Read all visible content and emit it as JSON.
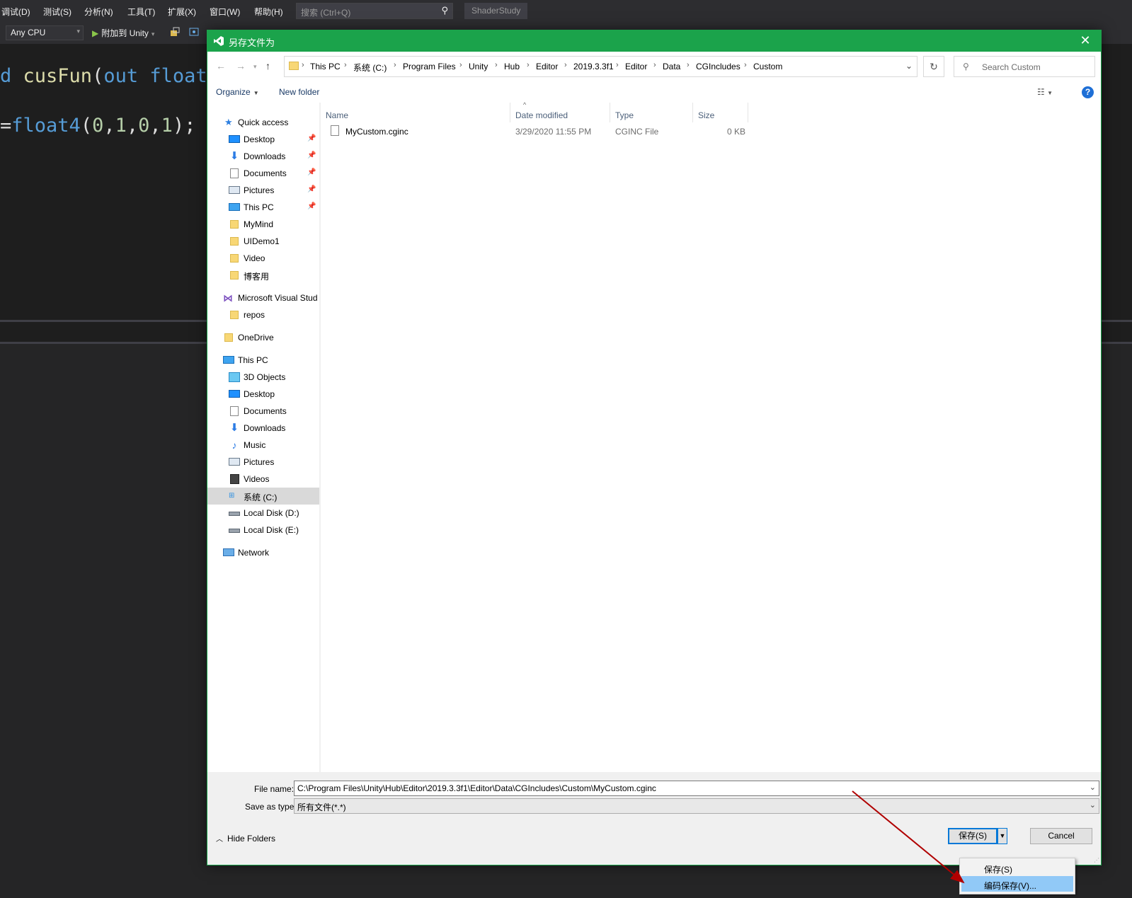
{
  "vs": {
    "menu": [
      "调试(D)",
      "测试(S)",
      "分析(N)",
      "工具(T)",
      "扩展(X)",
      "窗口(W)",
      "帮助(H)"
    ],
    "search_placeholder": "搜索 (Ctrl+Q)",
    "project_name": "ShaderStudy",
    "platform": "Any CPU",
    "run_label": "附加到 Unity",
    "code": {
      "line1": {
        "frag_d": "d",
        "fn": "cusFun",
        "paren": "(",
        "kw_out": "out",
        "kw_float": "float"
      },
      "line2": {
        "eq": "=",
        "fn": "float4",
        "open": "(",
        "args": [
          "0",
          "1",
          "0",
          "1"
        ],
        "close": ");"
      }
    }
  },
  "dialog": {
    "title": "另存文件为",
    "close_glyph": "✕",
    "breadcrumb": [
      "This PC",
      "系统 (C:)",
      "Program Files",
      "Unity",
      "Hub",
      "Editor",
      "2019.3.3f1",
      "Editor",
      "Data",
      "CGIncludes",
      "Custom"
    ],
    "search_placeholder": "Search Custom",
    "toolbar": {
      "organize": "Organize",
      "new_folder": "New folder",
      "help": "?"
    },
    "nav": [
      {
        "label": "Quick access",
        "icon": "star-icon"
      },
      {
        "label": "Desktop",
        "icon": "desktop-icon",
        "pinned": true
      },
      {
        "label": "Downloads",
        "icon": "download-icon",
        "pinned": true
      },
      {
        "label": "Documents",
        "icon": "documents-icon",
        "pinned": true
      },
      {
        "label": "Pictures",
        "icon": "pictures-icon",
        "pinned": true
      },
      {
        "label": "This PC",
        "icon": "computer-icon",
        "pinned": true
      },
      {
        "label": "MyMind",
        "icon": "folder-icon"
      },
      {
        "label": "UIDemo1",
        "icon": "folder-icon"
      },
      {
        "label": "Video",
        "icon": "folder-icon"
      },
      {
        "label": "博客用",
        "icon": "folder-icon"
      },
      {
        "label": "Microsoft Visual Stud",
        "icon": "visual-studio-icon"
      },
      {
        "label": "repos",
        "icon": "folder-icon"
      },
      {
        "label": "OneDrive",
        "icon": "onedrive-folder-icon"
      },
      {
        "label": "This PC",
        "icon": "computer-icon"
      },
      {
        "label": "3D Objects",
        "icon": "3d-objects-icon"
      },
      {
        "label": "Desktop",
        "icon": "desktop-icon"
      },
      {
        "label": "Documents",
        "icon": "documents-icon"
      },
      {
        "label": "Downloads",
        "icon": "download-icon"
      },
      {
        "label": "Music",
        "icon": "music-icon"
      },
      {
        "label": "Pictures",
        "icon": "pictures-icon"
      },
      {
        "label": "Videos",
        "icon": "videos-icon"
      },
      {
        "label": "系统 (C:)",
        "icon": "windows-drive-icon",
        "selected": true
      },
      {
        "label": "Local Disk (D:)",
        "icon": "disk-icon"
      },
      {
        "label": "Local Disk (E:)",
        "icon": "disk-icon"
      },
      {
        "label": "Network",
        "icon": "network-icon"
      }
    ],
    "columns": [
      "Name",
      "Date modified",
      "Type",
      "Size"
    ],
    "files": [
      {
        "name": "MyCustom.cginc",
        "date": "3/29/2020 11:55 PM",
        "type": "CGINC File",
        "size": "0 KB"
      }
    ],
    "file_name_label": "File name:",
    "file_name_value": "C:\\Program Files\\Unity\\Hub\\Editor\\2019.3.3f1\\Editor\\Data\\CGIncludes\\Custom\\MyCustom.cginc",
    "save_type_label": "Save as type:",
    "save_type_value": "所有文件(*.*)",
    "hide_folders": "Hide Folders",
    "save_label": "保存(S)",
    "cancel_label": "Cancel",
    "save_menu": [
      "保存(S)",
      "编码保存(V)..."
    ]
  },
  "colors": {
    "accent_green": "#1ba34b",
    "menu_highlight": "#91c9f7",
    "annotation_arrow": "#b00000"
  }
}
